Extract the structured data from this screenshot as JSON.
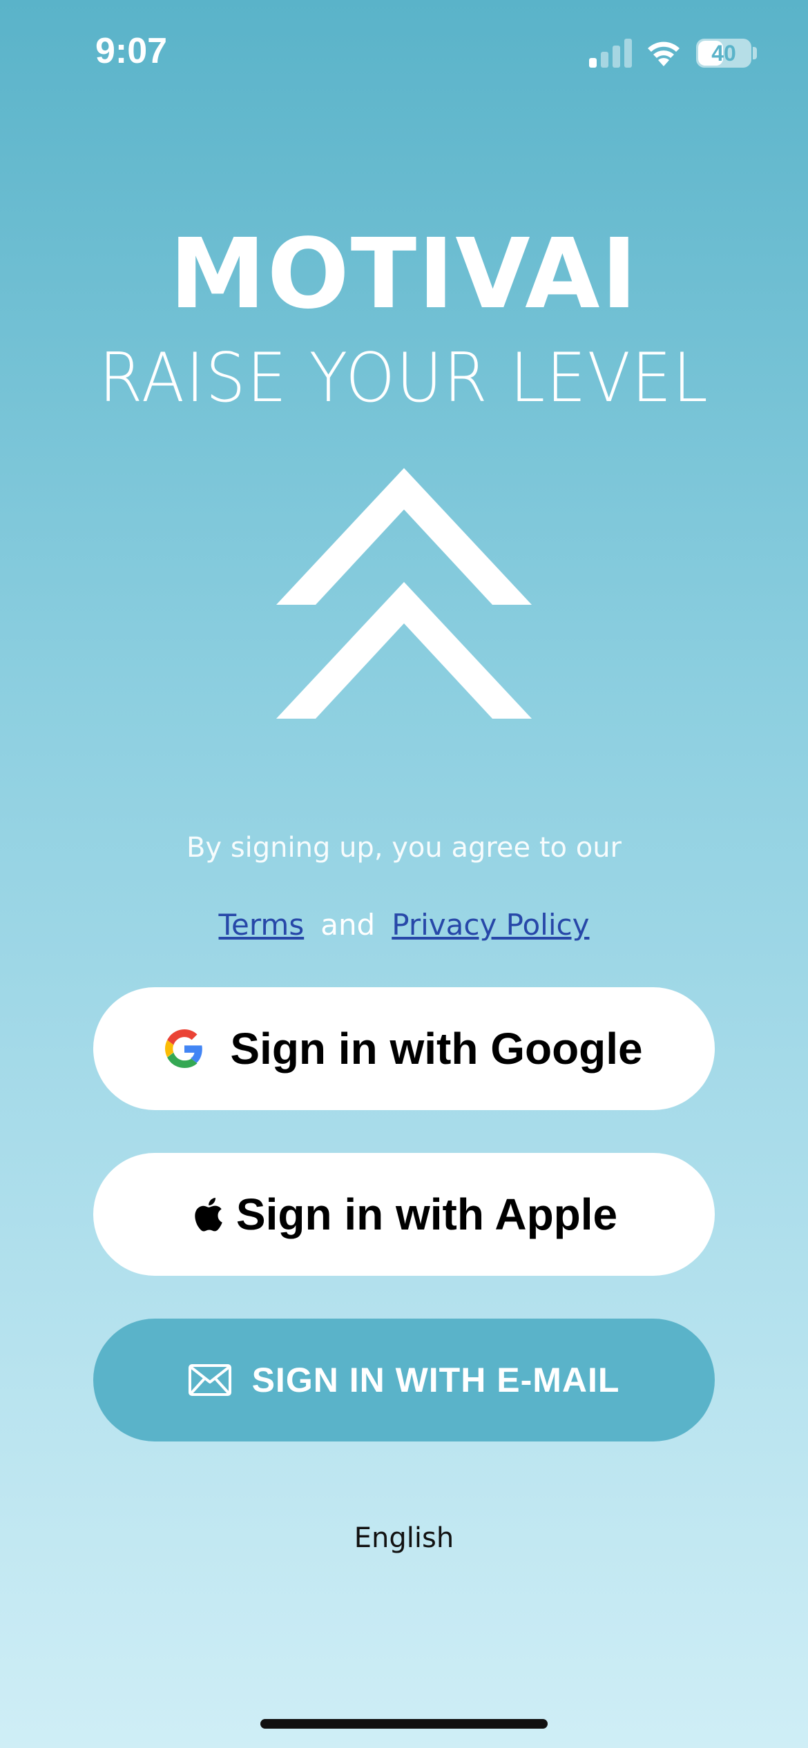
{
  "status_bar": {
    "time": "9:07",
    "battery_level": "40",
    "icons": [
      "cellular-signal-icon",
      "wifi-icon",
      "battery-icon"
    ]
  },
  "header": {
    "brand": "MOTIVAI",
    "tagline": "RAISE YOUR LEVEL"
  },
  "logo": {
    "icon": "double-chevron-up-icon",
    "color": "#ffffff"
  },
  "legal": {
    "prefix": "By signing up, you agree to our",
    "terms_label": "Terms",
    "conjunction": "and",
    "privacy_label": "Privacy Policy",
    "link_color": "#2747a8"
  },
  "buttons": {
    "google": {
      "label": "Sign in with Google",
      "icon": "google-logo-icon"
    },
    "apple": {
      "label": "Sign in with Apple",
      "icon": "apple-logo-icon"
    },
    "email": {
      "label": "SIGN IN WITH E-MAIL",
      "icon": "envelope-icon",
      "color": "#5ab3c9"
    }
  },
  "footer": {
    "language": "English"
  },
  "colors": {
    "background_top": "#5ab3c9",
    "background_bottom": "#cfeef6",
    "text_primary": "#ffffff"
  }
}
